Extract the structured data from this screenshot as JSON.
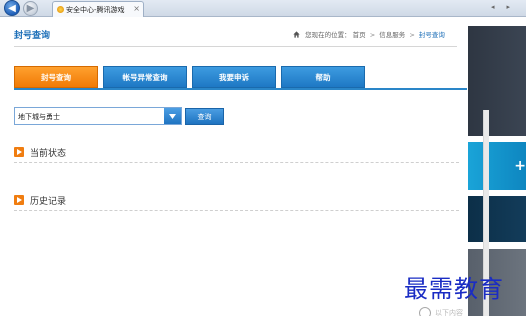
{
  "browser": {
    "tab_title": "安全中心-腾讯游戏",
    "tab_close": "×",
    "back_icon": "back-arrow-icon",
    "forward_icon": "forward-arrow-icon"
  },
  "header": {
    "title": "封号查询",
    "breadcrumb_prefix": "您现在的位置：",
    "breadcrumb": [
      "首页",
      "信息服务",
      "封号查询"
    ],
    "breadcrumb_sep": ">"
  },
  "nav_tabs": [
    {
      "label": "封号查询",
      "active": true
    },
    {
      "label": "帐号异常查询",
      "active": false
    },
    {
      "label": "我要申诉",
      "active": false
    },
    {
      "label": "帮助",
      "active": false
    }
  ],
  "search": {
    "game_selected": "地下城与勇士",
    "query_button": "查询"
  },
  "sections": {
    "status": "当前状态",
    "history": "历史记录"
  },
  "side_panel": {
    "plus_symbol": "+"
  },
  "watermark": "最需教育",
  "bottom_badge_text": "以下内容",
  "colors": {
    "accent_blue": "#1e78c4",
    "accent_orange": "#f07a06",
    "title_blue": "#1d6fb8",
    "watermark_blue": "#1a2cc4"
  }
}
